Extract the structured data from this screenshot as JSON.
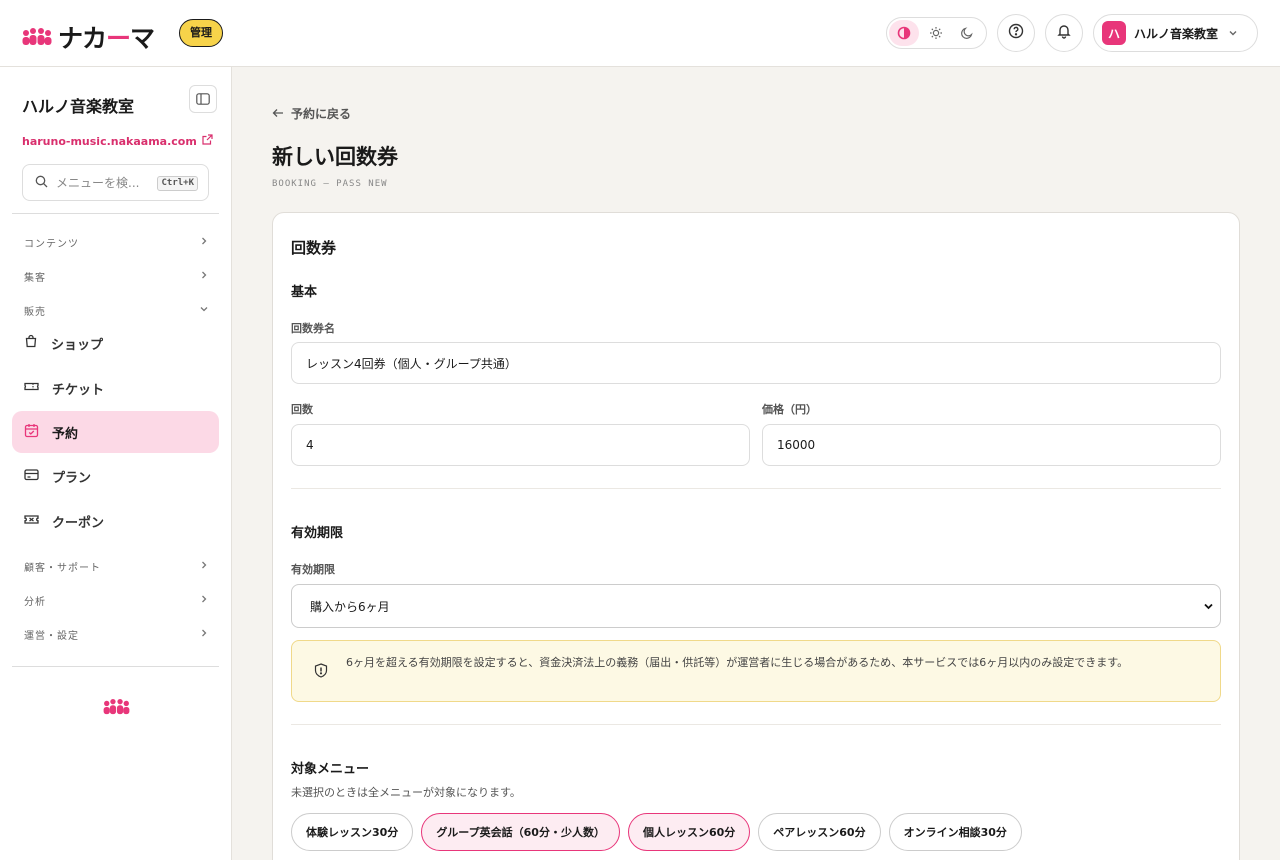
{
  "header": {
    "brand_name": "ナカーマ",
    "brand_name_parts": {
      "before": "ナカ",
      "dash": "ー",
      "after": "マ"
    },
    "admin_badge": "管理",
    "account_initial": "ハ",
    "account_name": "ハルノ音楽教室",
    "theme_options": [
      "contrast-icon",
      "sun-icon",
      "moon-icon"
    ],
    "theme_active": "contrast-icon"
  },
  "sidebar": {
    "org_name": "ハルノ音楽教室",
    "org_url": "haruno-music.nakaama.com",
    "search_placeholder": "メニューを検...",
    "search_shortcut": "Ctrl+K",
    "sections": {
      "contents": "コンテンツ",
      "marketing": "集客",
      "sales": "販売",
      "customer": "顧客・サポート",
      "analytics": "分析",
      "settings": "運営・設定"
    },
    "items": [
      {
        "label": "ショップ",
        "icon": "bag-icon"
      },
      {
        "label": "チケット",
        "icon": "ticket-icon"
      },
      {
        "label": "予約",
        "icon": "calendar-check-icon",
        "active": true
      },
      {
        "label": "プラン",
        "icon": "card-icon"
      },
      {
        "label": "クーポン",
        "icon": "coupon-icon"
      }
    ]
  },
  "page": {
    "back_label": "予約に戻る",
    "title": "新しい回数券",
    "subtitle": "BOOKING — PASS NEW"
  },
  "form": {
    "card_title": "回数券",
    "basic_heading": "基本",
    "name_label": "回数券名",
    "name_value": "レッスン4回券（個人・グループ共通）",
    "count_label": "回数",
    "count_value": "4",
    "price_label": "価格（円）",
    "price_value": "16000",
    "validity_heading": "有効期限",
    "validity_label": "有効期限",
    "validity_value": "購入から6ヶ月",
    "notice": "6ヶ月を超える有効期限を設定すると、資金決済法上の義務（届出・供託等）が運営者に生じる場合があるため、本サービスでは6ヶ月以内のみ設定できます。",
    "menu_heading": "対象メニュー",
    "menu_hint": "未選択のときは全メニューが対象になります。",
    "menus": [
      {
        "label": "体験レッスン30分",
        "selected": false
      },
      {
        "label": "グループ英会話（60分・少人数）",
        "selected": true
      },
      {
        "label": "個人レッスン60分",
        "selected": true
      },
      {
        "label": "ペアレッスン60分",
        "selected": false
      },
      {
        "label": "オンライン相談30分",
        "selected": false
      }
    ]
  },
  "colors": {
    "accent": "#e8367a",
    "badge": "#f7d34a",
    "active_nav": "#fcd9e6"
  }
}
